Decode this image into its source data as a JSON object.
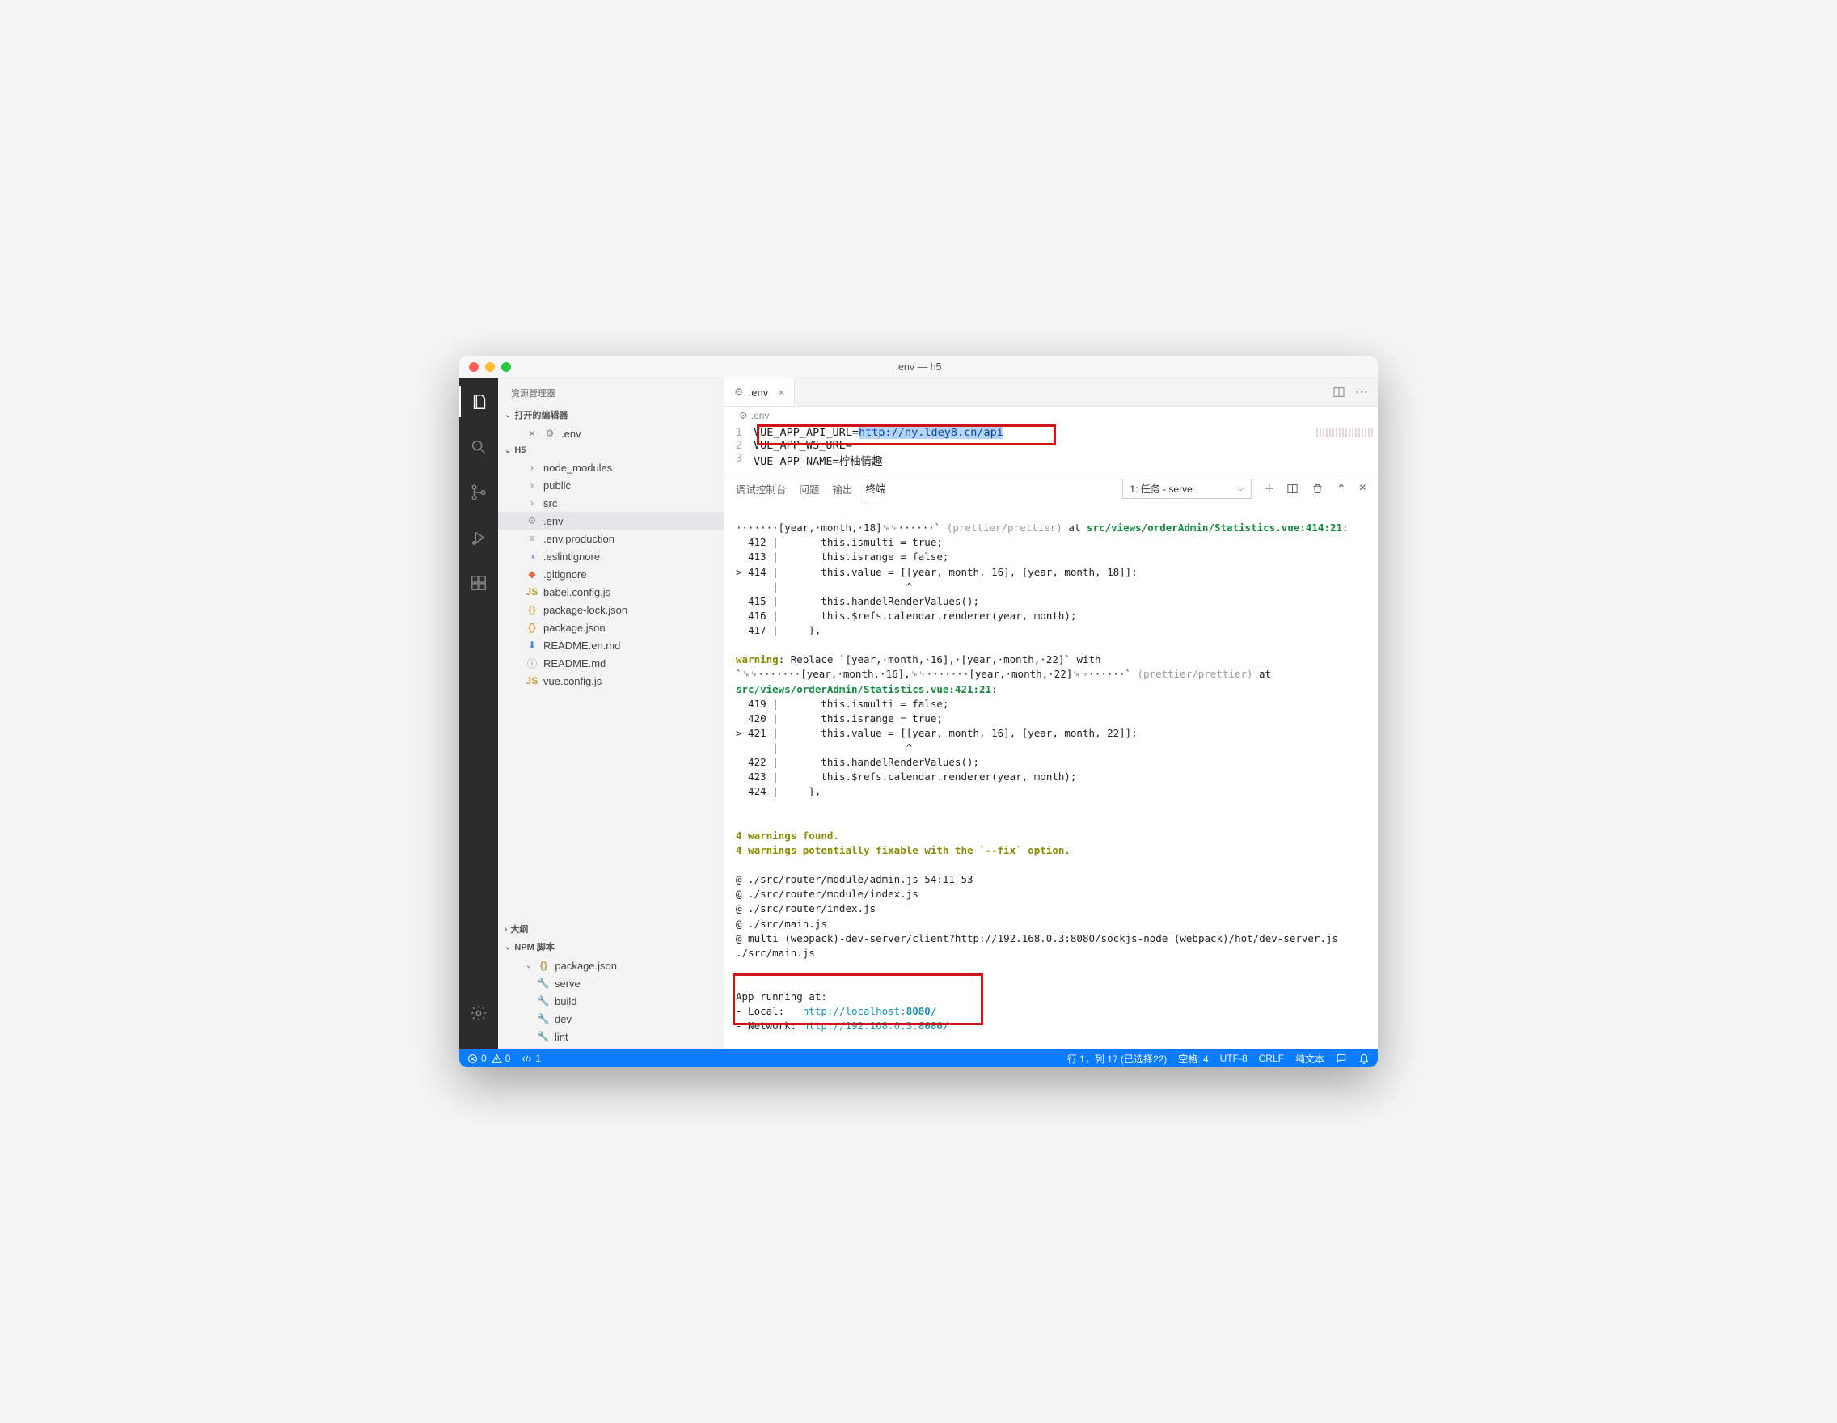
{
  "title": ".env — h5",
  "sidebar": {
    "title": "资源管理器",
    "sections": {
      "open_editors": "打开的编辑器",
      "project": "H5",
      "outline": "大纲",
      "npm": "NPM 脚本"
    },
    "open_file": ".env",
    "files": {
      "node_modules": "node_modules",
      "public": "public",
      "src": "src",
      "env": ".env",
      "env_prod": ".env.production",
      "eslintignore": ".eslintignore",
      "gitignore": ".gitignore",
      "babel": "babel.config.js",
      "pkglock": "package-lock.json",
      "pkg": "package.json",
      "readme_en": "README.en.md",
      "readme": "README.md",
      "vuecfg": "vue.config.js"
    },
    "npm_scripts": {
      "pkg": "package.json",
      "serve": "serve",
      "build": "build",
      "dev": "dev",
      "lint": "lint"
    }
  },
  "tab": {
    "name": ".env"
  },
  "breadcrumb": ".env",
  "code": {
    "l1a": "VUE_APP_API_URL=",
    "l1b": "http://ny.ldey8.cn/api",
    "l2": "VUE_APP_WS_URL=",
    "l3": "VUE_APP_NAME=柠柚情趣"
  },
  "panel": {
    "tabs": {
      "debug": "调试控制台",
      "problems": "问题",
      "output": "输出",
      "terminal": "终端"
    },
    "task": "1: 任务 - serve"
  },
  "term": {
    "w1_pre": "·······[year,·month,·18]␍␊······` ",
    "w1_rule": "(prettier/prettier)",
    "w1_at": " at ",
    "w1_file": "src/views/orderAdmin/Statistics.vue:414:21",
    "w1_colon": ":",
    "b1_412": "  412 |       this.ismulti = true;",
    "b1_413": "  413 |       this.isrange = false;",
    "b1_414": "> 414 |       this.value = [[year, month, 16], [year, month, 18]];",
    "b1_caret": "      |                     ^",
    "b1_415": "  415 |       this.handelRenderValues();",
    "b1_416": "  416 |       this.$refs.calendar.renderer(year, month);",
    "b1_417": "  417 |     },",
    "w2_pre": "warning",
    "w2_msg": ": Replace `[year,·month,·16],·[year,·month,·22]` with `␍␊·······[year,·month,·16],␍␊·······[year,·month,·22]␍␊······` ",
    "w2_rule": "(prettier/prettier)",
    "w2_at": " at ",
    "w2_file": "src/views/orderAdmin/Statistics.vue:421:21",
    "b2_419": "  419 |       this.ismulti = false;",
    "b2_420": "  420 |       this.isrange = true;",
    "b2_421": "> 421 |       this.value = [[year, month, 16], [year, month, 22]];",
    "b2_caret": "      |                     ^",
    "b2_422": "  422 |       this.handelRenderValues();",
    "b2_423": "  423 |       this.$refs.calendar.renderer(year, month);",
    "b2_424": "  424 |     },",
    "warn_found": "4 warnings found.",
    "warn_fix": "4 warnings potentially fixable with the `--fix` option.",
    "mod1": "@ ./src/router/module/admin.js 54:11-53",
    "mod2": "@ ./src/router/module/index.js",
    "mod3": "@ ./src/router/index.js",
    "mod4": "@ ./src/main.js",
    "mod5": "@ multi (webpack)-dev-server/client?http://192.168.0.3:8080/sockjs-node (webpack)/hot/dev-server.js ./src/main.js",
    "app_running": "App running at:",
    "local_lbl": "- Local:   ",
    "local_url": "http://localhost:",
    "local_port": "8080/",
    "net_lbl": "- Network: ",
    "net_url": "http://192.168.0.3:",
    "net_port": "8080/"
  },
  "status": {
    "errors": "0",
    "warnings": "0",
    "ports": "1",
    "cursor": "行 1，列 17 (已选择22)",
    "spaces": "空格: 4",
    "encoding": "UTF-8",
    "eol": "CRLF",
    "lang": "纯文本"
  }
}
